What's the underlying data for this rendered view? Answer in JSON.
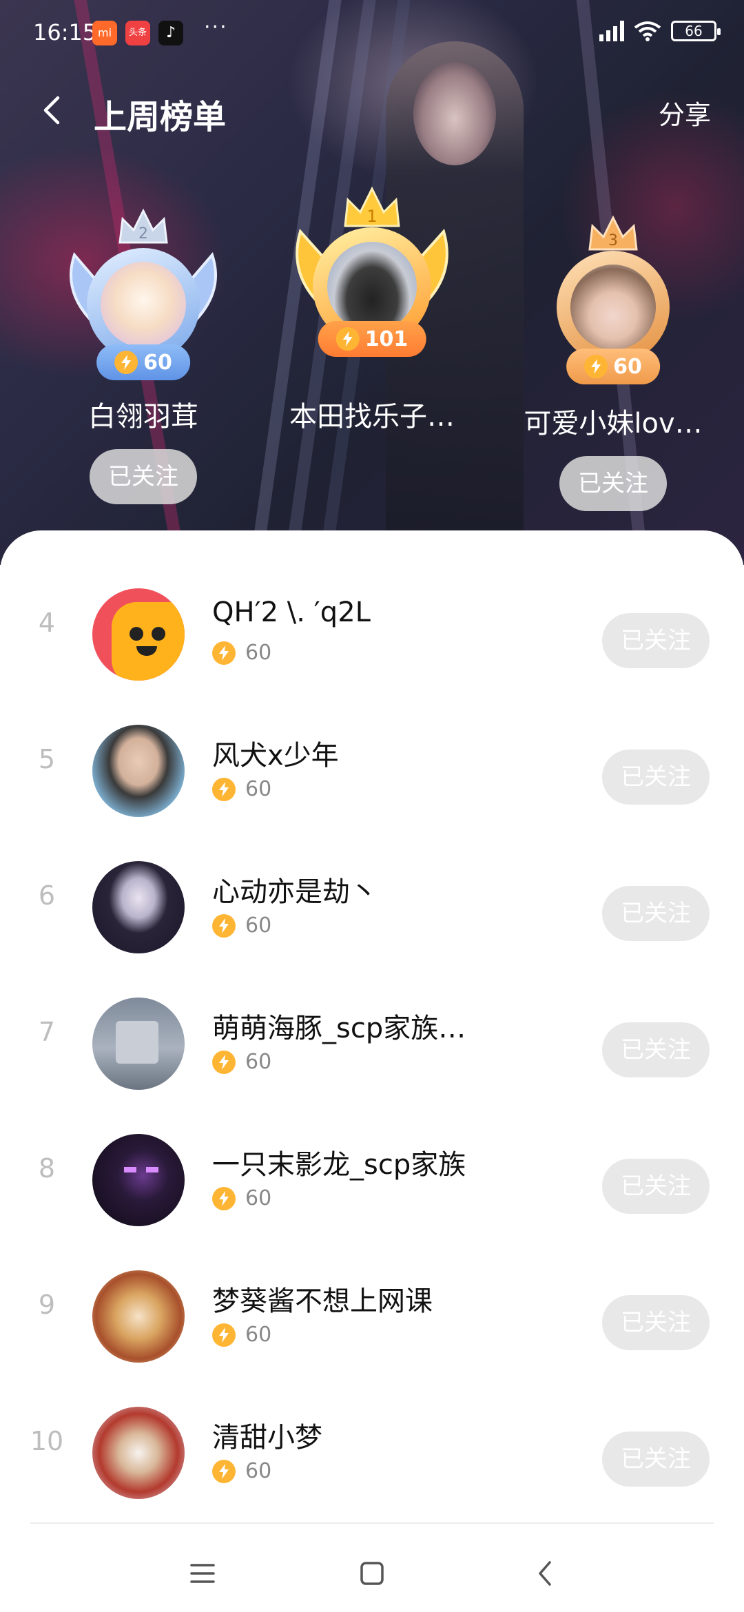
{
  "status_bar": {
    "time": "16:15",
    "apps": [
      {
        "icon": "xiaomi-store-icon",
        "label": "mi",
        "color": "#ff6a2a"
      },
      {
        "icon": "toutiao-icon",
        "label": "头条",
        "color": "#f04142"
      },
      {
        "icon": "douyin-icon",
        "label": "♪",
        "color": "#111111"
      }
    ],
    "more": "···",
    "battery": "66"
  },
  "nav": {
    "title": "上周榜单",
    "share_label": "分享"
  },
  "podium": {
    "first": {
      "rank": "1",
      "name": "本田找乐子…",
      "score": "101"
    },
    "second": {
      "rank": "2",
      "name": "白翎羽茸",
      "score": "60",
      "follow_label": "已关注"
    },
    "third": {
      "rank": "3",
      "name": "可爱小妹lov…",
      "score": "60",
      "follow_label": "已关注"
    }
  },
  "list": [
    {
      "rank": "4",
      "name": "QH′2 \\. ′q2L",
      "score": "60",
      "follow_label": "已关注"
    },
    {
      "rank": "5",
      "name": "风犬x少年",
      "score": "60",
      "follow_label": "已关注"
    },
    {
      "rank": "6",
      "name": "心动亦是劫丶",
      "score": "60",
      "follow_label": "已关注"
    },
    {
      "rank": "7",
      "name": "萌萌海豚_scp家族…",
      "score": "60",
      "follow_label": "已关注"
    },
    {
      "rank": "8",
      "name": "一只末影龙_scp家族",
      "score": "60",
      "follow_label": "已关注"
    },
    {
      "rank": "9",
      "name": "梦葵酱不想上网课",
      "score": "60",
      "follow_label": "已关注"
    },
    {
      "rank": "10",
      "name": "清甜小梦",
      "score": "60",
      "follow_label": "已关注"
    }
  ],
  "colors": {
    "gold": "#ffb534",
    "silver": "#8fb7f0",
    "bronze": "#f2a658",
    "follow_bg": "#e8e8e8"
  }
}
